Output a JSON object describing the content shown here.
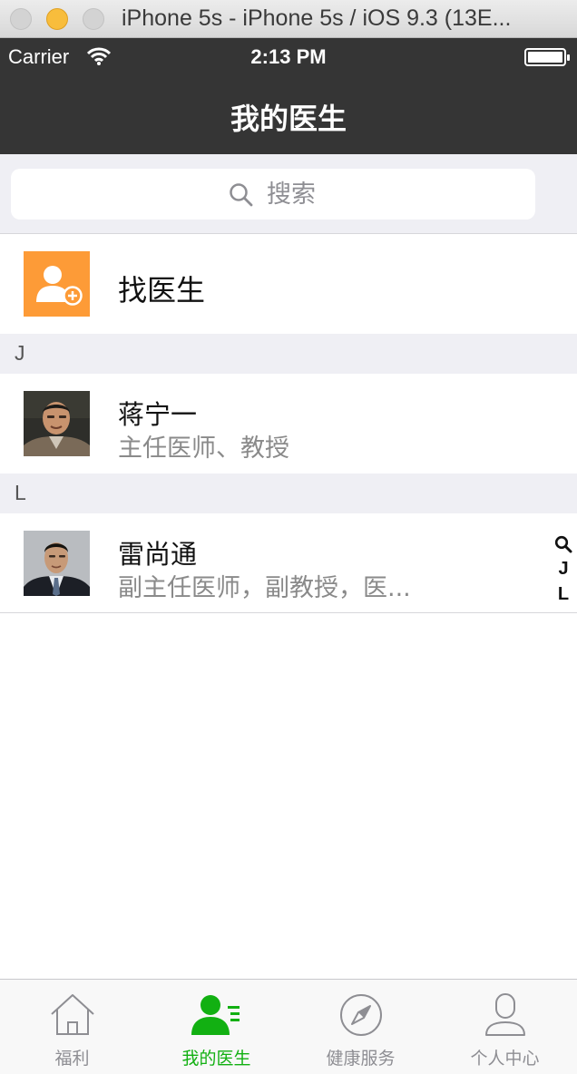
{
  "window": {
    "title": "iPhone 5s - iPhone 5s / iOS 9.3 (13E..."
  },
  "status_bar": {
    "carrier": "Carrier",
    "time": "2:13 PM"
  },
  "nav": {
    "title": "我的医生"
  },
  "search": {
    "placeholder": "搜索"
  },
  "find_doctor": {
    "label": "找医生",
    "icon": "add-user-icon",
    "color": "#fd9b37"
  },
  "sections": [
    {
      "letter": "J",
      "doctors": [
        {
          "name": "蒋宁一",
          "title": "主任医师、教授"
        }
      ]
    },
    {
      "letter": "L",
      "doctors": [
        {
          "name": "雷尚通",
          "title": "副主任医师，副教授，医..."
        }
      ]
    }
  ],
  "index": {
    "items": [
      "J",
      "L"
    ],
    "search_icon": "search-icon"
  },
  "tabbar": {
    "active_color": "#12b012",
    "tabs": [
      {
        "label": "福利",
        "icon": "home-icon",
        "active": false
      },
      {
        "label": "我的医生",
        "icon": "doctor-list-icon",
        "active": true
      },
      {
        "label": "健康服务",
        "icon": "compass-icon",
        "active": false
      },
      {
        "label": "个人中心",
        "icon": "person-icon",
        "active": false
      }
    ]
  }
}
